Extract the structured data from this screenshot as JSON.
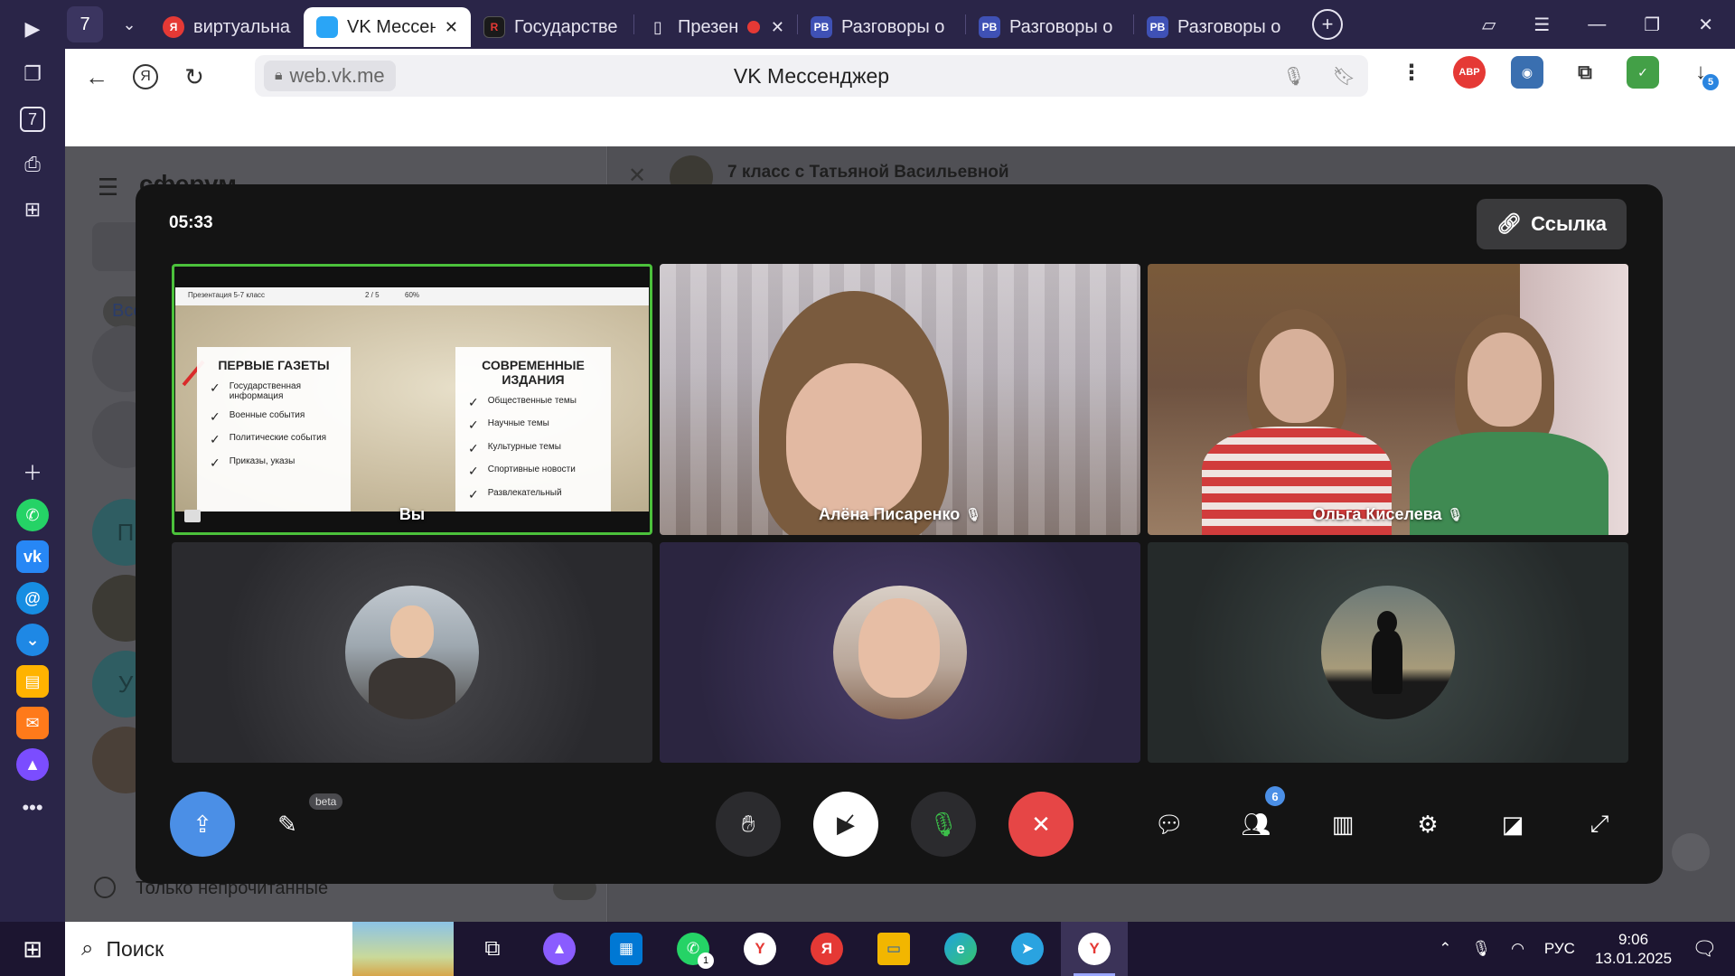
{
  "browser": {
    "tab_counter": "7",
    "tabs": [
      {
        "label": "виртуальная",
        "favicon": "Я",
        "favicon_color": "#e53935",
        "active": false
      },
      {
        "label": "VK Мессенджер",
        "favicon": "",
        "favicon_color": "#2aa5f6",
        "active": true,
        "close": "✕"
      },
      {
        "label": "Государстве",
        "favicon": "R",
        "favicon_color": "#222222",
        "active": false
      },
      {
        "label": "Презен",
        "favicon": "",
        "favicon_color": "#ffffff",
        "active": false,
        "recording": true,
        "close": "✕"
      },
      {
        "label": "Разговоры о",
        "favicon": "РВ",
        "favicon_color": "#3f51b5",
        "active": false
      },
      {
        "label": "Разговоры о",
        "favicon": "РВ",
        "favicon_color": "#3f51b5",
        "active": false
      },
      {
        "label": "Разговоры о",
        "favicon": "РВ",
        "favicon_color": "#3f51b5",
        "active": false
      }
    ],
    "url": "web.vk.me",
    "page_title": "VK Мессенджер",
    "downloads_badge": "5",
    "extension_abp": "ABP"
  },
  "leftbar": {
    "counter": "7"
  },
  "vk": {
    "logo_text": "сферум",
    "chat_title": "7 класс с Татьяной Васильевной",
    "filter_label": "Только непрочитанные",
    "tab_all": "Все",
    "avatar_letters": [
      "П",
      "У"
    ]
  },
  "call": {
    "timer": "05:33",
    "link_button": "Ссылка",
    "participants": [
      {
        "name": "Вы",
        "type": "screen",
        "speaking": true,
        "muted": false
      },
      {
        "name": "Алёна Писаренко",
        "type": "video",
        "muted": true
      },
      {
        "name": "Ольга Киселева",
        "type": "video",
        "muted": true
      },
      {
        "name": "",
        "type": "avatar"
      },
      {
        "name": "",
        "type": "avatar"
      },
      {
        "name": "",
        "type": "avatar"
      }
    ],
    "presentation": {
      "title_bar": "Презентация 5-7 класс",
      "page": "2 / 5",
      "zoom": "60%",
      "left_heading": "ПЕРВЫЕ ГАЗЕТЫ",
      "left_items": [
        "Государственная информация",
        "Военные события",
        "Политические события",
        "Приказы, указы"
      ],
      "right_heading": "СОВРЕМЕННЫЕ ИЗДАНИЯ",
      "right_items": [
        "Общественные темы",
        "Научные темы",
        "Культурные темы",
        "Спортивные новости",
        "Развлекательный"
      ]
    },
    "controls": {
      "beta_label": "beta",
      "participants_count": "6"
    }
  },
  "taskbar": {
    "search_label": "Поиск",
    "whatsapp_badge": "1",
    "lang": "РУС",
    "time": "9:06",
    "date": "13.01.2025"
  }
}
